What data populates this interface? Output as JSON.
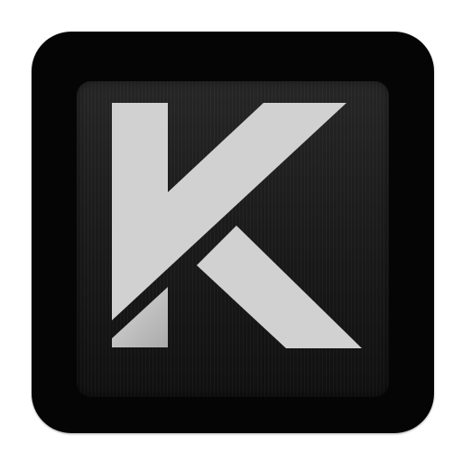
{
  "icon": {
    "name": "k-app-icon",
    "logo_letter": "K",
    "colors": {
      "outer_frame": "#050505",
      "panel": "#1b1b1b",
      "letter": "#d1d1d1"
    }
  }
}
